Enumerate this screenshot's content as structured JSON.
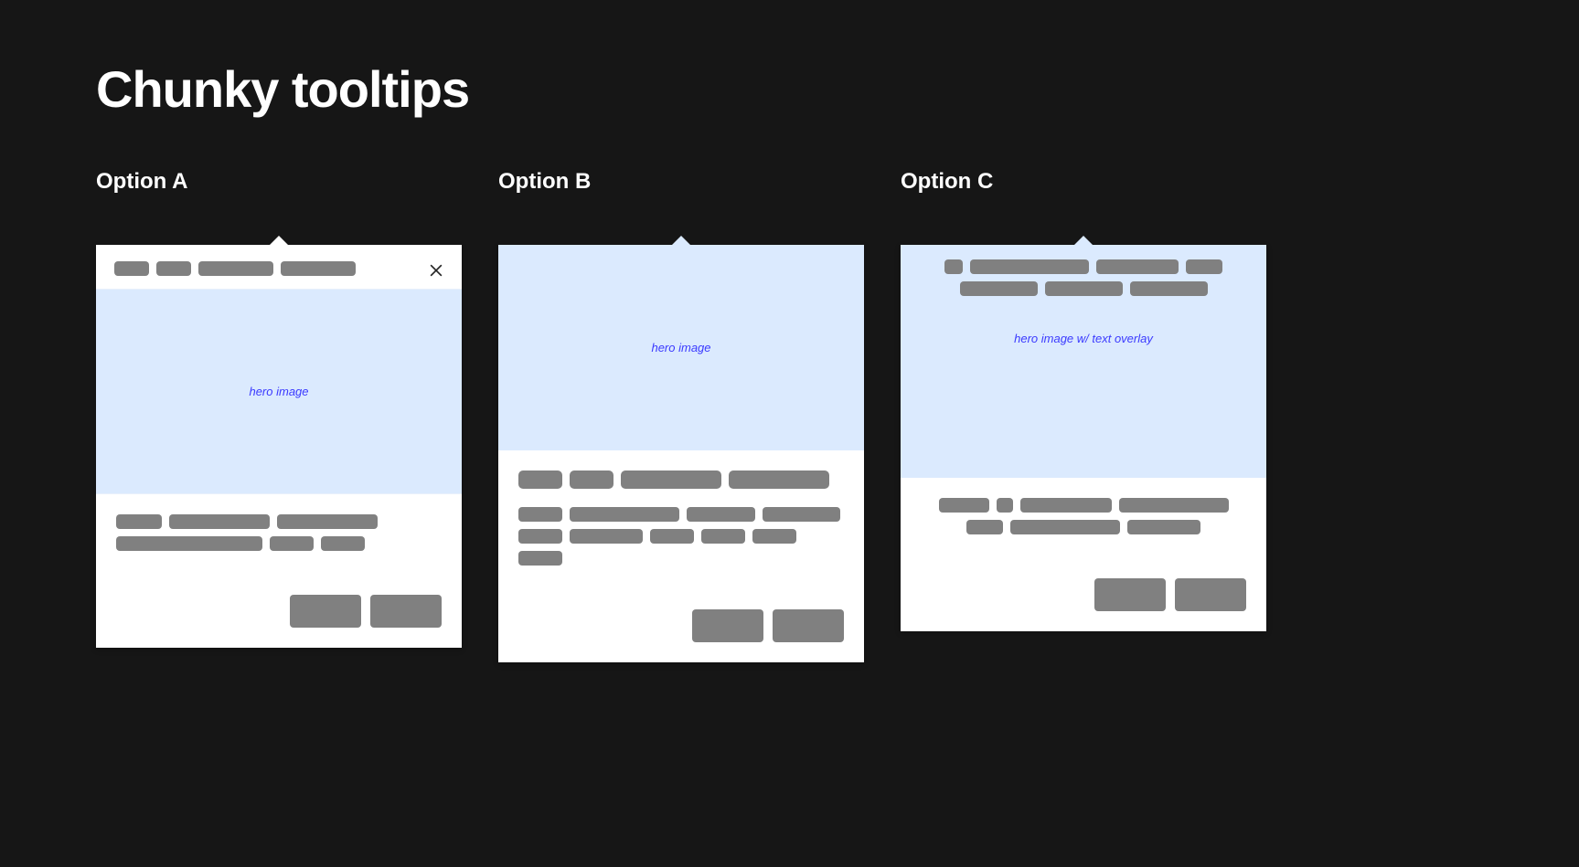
{
  "title": "Chunky tooltips",
  "options": {
    "a": {
      "label": "Option A",
      "hero_label": "hero image"
    },
    "b": {
      "label": "Option B",
      "hero_label": "hero image"
    },
    "c": {
      "label": "Option C",
      "hero_label": "hero image w/ text overlay"
    }
  }
}
